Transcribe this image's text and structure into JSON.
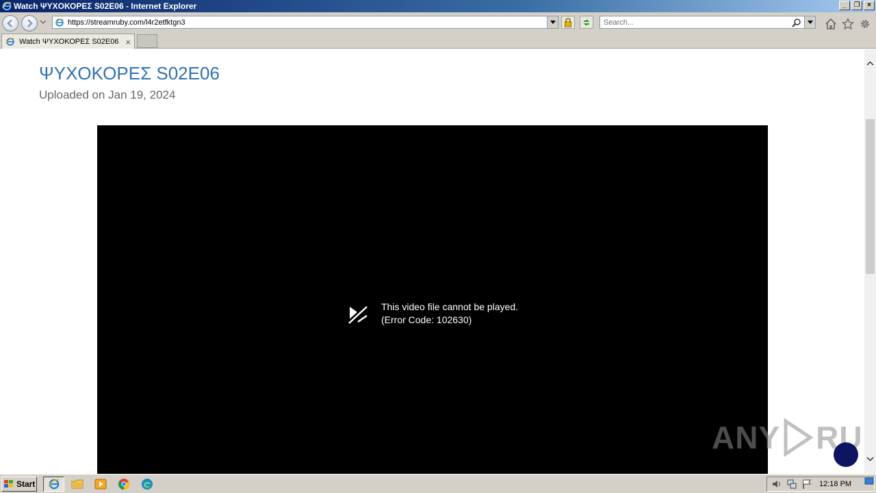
{
  "window": {
    "title": "Watch ΨΥΧΟΚΟΡΕΣ S02E06 - Internet Explorer"
  },
  "navbar": {
    "url": "https://streamruby.com/l4r2etfktgn3",
    "search_placeholder": "Search..."
  },
  "tabs": [
    {
      "label": "Watch ΨΥΧΟΚΟΡΕΣ S02E06",
      "close": "×"
    }
  ],
  "page": {
    "title": "ΨΥΧΟΚΟΡΕΣ S02E06",
    "uploaded": "Uploaded on Jan 19, 2024",
    "player": {
      "error_line1": "This video file cannot be played.",
      "error_line2": "(Error Code: 102630)"
    },
    "watermark": {
      "left": "ANY",
      "right": "RUN"
    }
  },
  "taskbar": {
    "start_label": "Start",
    "clock": "12:18 PM"
  },
  "colors": {
    "title_link": "#2f72b0",
    "player_bg": "#000000",
    "help_bubble": "#0d1460"
  },
  "icons": {
    "window": "internet-explorer-icon",
    "back": "back-arrow-icon",
    "forward": "forward-arrow-icon",
    "lock": "lock-icon",
    "refresh": "refresh-icon",
    "search": "magnifier-icon",
    "home": "home-icon",
    "favorites": "star-icon",
    "tools": "gear-icon",
    "error": "video-error-icon"
  }
}
